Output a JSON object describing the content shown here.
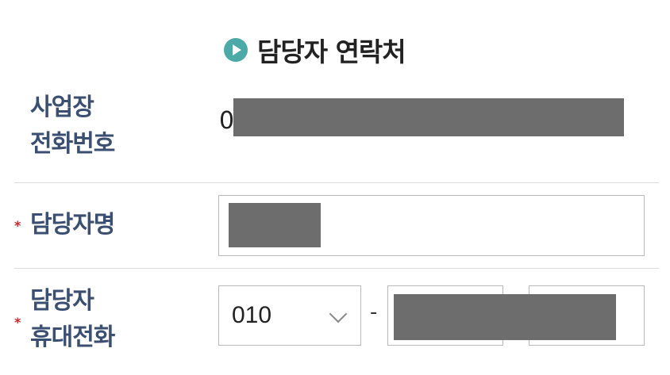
{
  "section": {
    "title": "담당자 연락처",
    "icon": "play-circle-icon",
    "icon_color": "#4ba9a8"
  },
  "fields": {
    "business_phone": {
      "label_line1": "사업장",
      "label_line2": "전화번호",
      "value_prefix": "0"
    },
    "manager_name": {
      "required_mark": "*",
      "label": "담당자명"
    },
    "manager_mobile": {
      "required_mark": "*",
      "label_line1": "담당자",
      "label_line2": "휴대전화",
      "prefix_selected": "010",
      "separator": "-"
    }
  },
  "colors": {
    "label": "#3a4f72",
    "required": "#c8262b",
    "redaction": "#6d6d6d"
  }
}
